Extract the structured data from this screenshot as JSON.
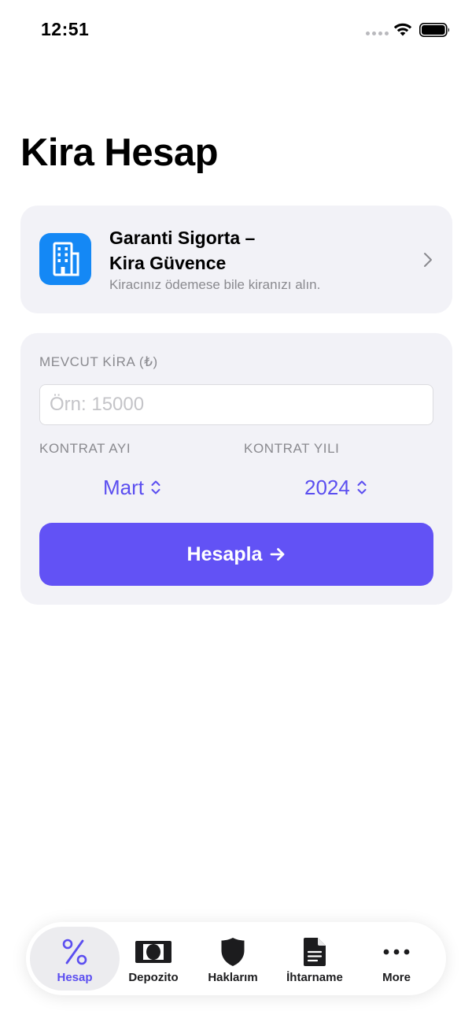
{
  "status_bar": {
    "time": "12:51"
  },
  "page": {
    "title": "Kira Hesap"
  },
  "promo": {
    "title": "Garanti Sigorta –\nKira Güvence",
    "subtitle": "Kiracınız ödemese bile kiranızı alın."
  },
  "form": {
    "rent_label": "MEVCUT KİRA (₺)",
    "rent_value": "",
    "rent_placeholder": "Örn: 15000",
    "month_label": "KONTRAT AYI",
    "month_value": "Mart",
    "year_label": "KONTRAT YILI",
    "year_value": "2024",
    "calculate_label": "Hesapla"
  },
  "tab_bar": {
    "items": [
      {
        "label": "Hesap",
        "icon": "percent-icon",
        "active": true
      },
      {
        "label": "Depozito",
        "icon": "banknote-icon",
        "active": false
      },
      {
        "label": "Haklarım",
        "icon": "shield-icon",
        "active": false
      },
      {
        "label": "İhtarname",
        "icon": "document-icon",
        "active": false
      },
      {
        "label": "More",
        "icon": "ellipsis-icon",
        "active": false
      }
    ]
  },
  "colors": {
    "accent": "#5b4ef0",
    "button": "#6252f5",
    "card_bg": "#f2f2f7",
    "promo_icon_bg": "#1488f5",
    "secondary_text": "#8a8a8f"
  }
}
